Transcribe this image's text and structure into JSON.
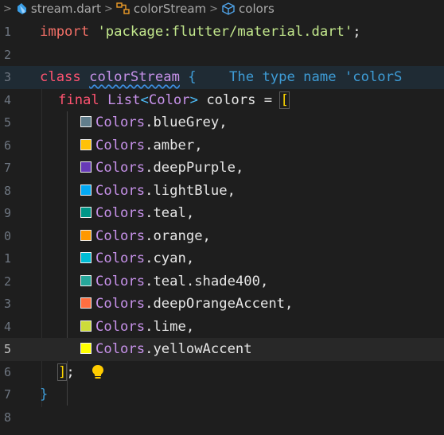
{
  "breadcrumb": {
    "file": "stream.dart",
    "class": "colorStream",
    "field": "colors"
  },
  "colors": {
    "blueGrey": "#607d8b",
    "amber": "#ffc107",
    "deepPurple": "#673ab7",
    "lightBlue": "#03a9f4",
    "teal": "#009688",
    "orange": "#ff9800",
    "cyan": "#00bcd4",
    "tealShade400": "#26a69a",
    "deepOrangeAccent": "#ff6e40",
    "lime": "#cddc39",
    "yellowAccent": "#ffff00"
  },
  "lines": {
    "l1": {
      "num": "1",
      "kw": "import",
      "sp": " ",
      "str": "'package:flutter/material.dart'",
      "end": ";"
    },
    "l2": {
      "num": "2"
    },
    "l3": {
      "num": "3",
      "kw": "class",
      "sp": " ",
      "name": "colorStream",
      "sp2": " ",
      "brace": "{",
      "hint": "    The type name 'colorS"
    },
    "l4": {
      "num": "4",
      "kw": "final",
      "sp": " ",
      "type": "List",
      "lt": "<",
      "type2": "Color",
      "gt": ">",
      "ident": " colors = ",
      "bracket": "["
    },
    "l5": {
      "num": "5",
      "cls": "Colors",
      "dot": ".",
      "member": "blueGrey",
      "end": ","
    },
    "l6": {
      "num": "6",
      "cls": "Colors",
      "dot": ".",
      "member": "amber",
      "end": ","
    },
    "l7": {
      "num": "7",
      "cls": "Colors",
      "dot": ".",
      "member": "deepPurple",
      "end": ","
    },
    "l8": {
      "num": "8",
      "cls": "Colors",
      "dot": ".",
      "member": "lightBlue",
      "end": ","
    },
    "l9": {
      "num": "9",
      "cls": "Colors",
      "dot": ".",
      "member": "teal",
      "end": ","
    },
    "l10": {
      "num": "0",
      "cls": "Colors",
      "dot": ".",
      "member": "orange",
      "end": ","
    },
    "l11": {
      "num": "1",
      "cls": "Colors",
      "dot": ".",
      "member": "cyan",
      "end": ","
    },
    "l12": {
      "num": "2",
      "cls": "Colors",
      "dot": ".",
      "member": "teal.shade400",
      "end": ","
    },
    "l13": {
      "num": "3",
      "cls": "Colors",
      "dot": ".",
      "member": "deepOrangeAccent",
      "end": ","
    },
    "l14": {
      "num": "4",
      "cls": "Colors",
      "dot": ".",
      "member": "lime",
      "end": ","
    },
    "l15": {
      "num": "5",
      "cls": "Colors",
      "dot": ".",
      "member": "yellowAccent",
      "end": ""
    },
    "l16": {
      "num": "6",
      "bracket": "]",
      "end": ";"
    },
    "l17": {
      "num": "7",
      "brace": "}"
    },
    "l18": {
      "num": "8"
    }
  }
}
